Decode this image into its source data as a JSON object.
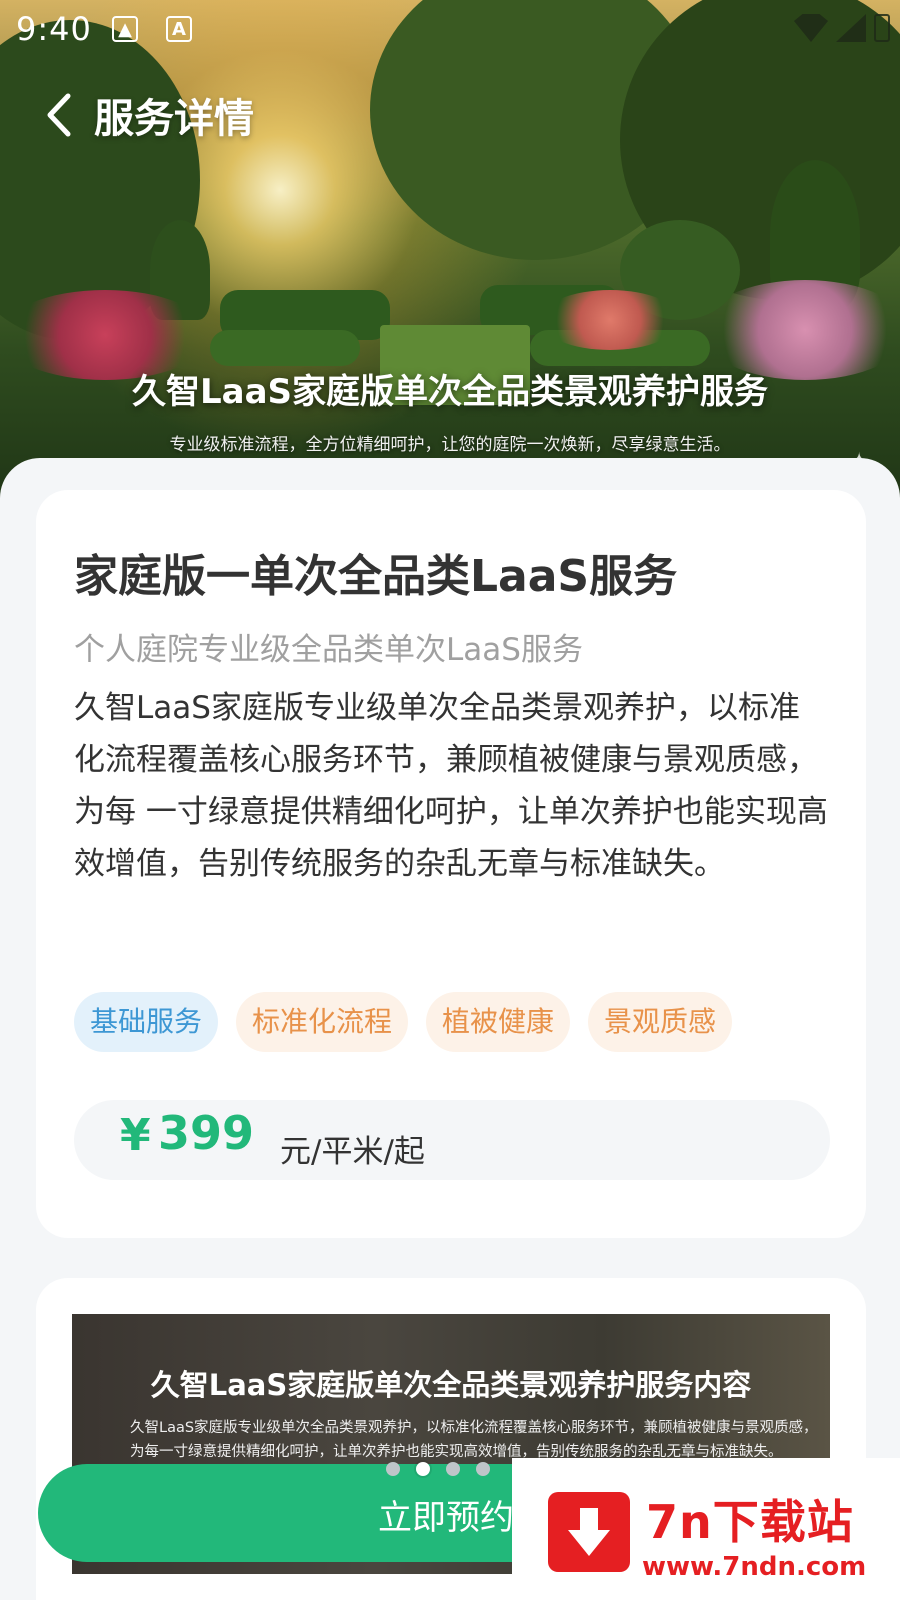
{
  "status_bar": {
    "time": "9:40",
    "icons": [
      "image-icon",
      "a-icon",
      "wifi-icon",
      "signal-icon",
      "battery-icon"
    ]
  },
  "nav": {
    "title": "服务详情",
    "back_icon": "chevron-left-icon"
  },
  "hero": {
    "title": "久智LaaS家庭版单次全品类景观养护服务",
    "subtitle": "专业级标准流程，全方位精细呵护，让您的庭院一次焕新，尽享绿意生活。"
  },
  "service": {
    "title": "家庭版一单次全品类LaaS服务",
    "subtitle": "个人庭院专业级全品类单次LaaS服务",
    "description": "久智LaaS家庭版专业级单次全品类景观养护，以标准化流程覆盖核心服务环节，兼顾植被健康与景观质感，为每 一寸绿意提供精细化呵护，让单次养护也能实现高效增值，告别传统服务的杂乱无章与标准缺失。",
    "tags": [
      {
        "label": "基础服务",
        "color": "#3d97d4",
        "bg": "#e3f1fb"
      },
      {
        "label": "标准化流程",
        "color": "#e8924a",
        "bg": "#fdf2e8"
      },
      {
        "label": "植被健康",
        "color": "#e8924a",
        "bg": "#fdf2e8"
      },
      {
        "label": "景观质感",
        "color": "#e8924a",
        "bg": "#fdf2e8"
      }
    ],
    "price": {
      "symbol": "¥",
      "value": "399",
      "unit": "元/平米/起"
    }
  },
  "banner": {
    "title": "久智LaaS家庭版单次全品类景观养护服务内容",
    "line1": "久智LaaS家庭版专业级单次全品类景观养护，以标准化流程覆盖核心服务环节，兼顾植被健康与景观质感，",
    "line2": "为每一寸绿意提供精细化呵护，让单次养护也能实现高效增值，告别传统服务的杂乱无章与标准缺失。",
    "dots_count": 4,
    "active_dot": 2
  },
  "action": {
    "book_label": "立即预约"
  },
  "watermark": {
    "title": "7n下载站",
    "url": "www.7ndn.com"
  },
  "colors": {
    "accent": "#22b87a",
    "watermark": "#e51f22"
  }
}
